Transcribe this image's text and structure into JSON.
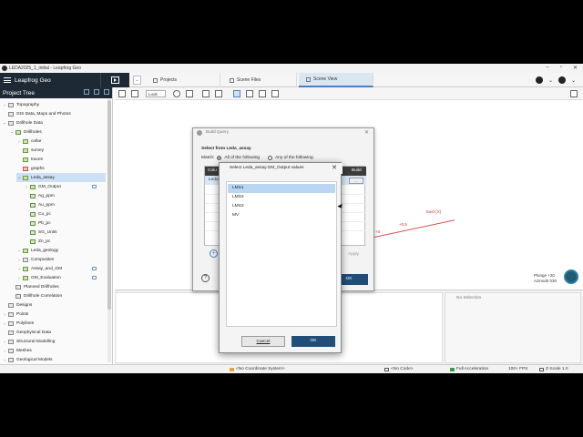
{
  "window": {
    "title": "LEDA2025_1_initial - Leapfrog Geo"
  },
  "app": {
    "brand": "Leapfrog Geo",
    "tabs": [
      {
        "label": "Projects"
      },
      {
        "label": "Scene Files"
      },
      {
        "label": "Scene View"
      }
    ]
  },
  "project_tree": {
    "title": "Project Tree",
    "items": [
      {
        "label": "Topography"
      },
      {
        "label": "GIS Data, Maps and Photos"
      },
      {
        "label": "Drillhole Data"
      },
      {
        "label": "Drillholes"
      },
      {
        "label": "collar"
      },
      {
        "label": "survey"
      },
      {
        "label": "traces"
      },
      {
        "label": "graphs"
      },
      {
        "label": "Leda_assay"
      },
      {
        "label": "GM_Output"
      },
      {
        "label": "Ag_ppm"
      },
      {
        "label": "Au_ppm"
      },
      {
        "label": "Cu_pc"
      },
      {
        "label": "Pb_pc"
      },
      {
        "label": "SG_Units"
      },
      {
        "label": "Zn_pc"
      },
      {
        "label": "Leda_geology"
      },
      {
        "label": "Composites"
      },
      {
        "label": "Assay_and_GM"
      },
      {
        "label": "GM_Evaluation"
      },
      {
        "label": "Planned Drillholes"
      },
      {
        "label": "Drillhole Correlation"
      },
      {
        "label": "Designs"
      },
      {
        "label": "Points"
      },
      {
        "label": "Polylines"
      },
      {
        "label": "Geophysical Data"
      },
      {
        "label": "Structural Modelling"
      },
      {
        "label": "Meshes"
      },
      {
        "label": "Geological Models"
      }
    ]
  },
  "scene_toolbar": {
    "look_label": "Look"
  },
  "viewport": {
    "east_label": "East (X)",
    "axis_tick_1": "+0.5",
    "axis_tick_2": "+0",
    "plunge": "Plunge +20",
    "azimuth": "Azimuth 030"
  },
  "selection_panel": {
    "label": "No Selection"
  },
  "status_bar": {
    "coordinate_system": "<No Coordinate System>",
    "code": "<No Code>",
    "acceleration": "Full Acceleration",
    "fps": "100+ FPS",
    "z_scale": "Z-Scale 1.0"
  },
  "build_query_dialog": {
    "title": "Build Query",
    "select_from": "Select from Leda_assay",
    "match_label": "Match:",
    "option_all": "All of the following",
    "option_any": "Any of the following",
    "col_header_left": "Colu",
    "col_header_right": "Build",
    "row_value": "Leda",
    "apply_label": "Apply",
    "ok_label": "OK"
  },
  "select_values_dialog": {
    "title": "Select Leda_assay.GM_Output values",
    "values": [
      "LMS1",
      "LMS2",
      "LMS3",
      "MV"
    ],
    "selected_index": 0,
    "cancel_label": "Cancel",
    "ok_label": "OK"
  },
  "colors": {
    "brand_dark": "#1d2a36",
    "primary_button": "#1f4e79",
    "selection": "#b9d6f2",
    "axis_red": "#d9534f"
  }
}
